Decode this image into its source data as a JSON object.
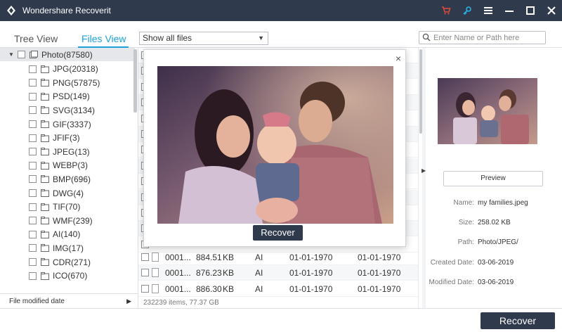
{
  "titlebar": {
    "app_name": "Wondershare Recoverit",
    "icons": [
      "logo-icon",
      "cart-icon",
      "key-icon",
      "menu-icon",
      "minimize-icon",
      "maximize-icon",
      "close-icon"
    ]
  },
  "toolbar": {
    "tab_tree": "Tree View",
    "tab_files": "Files View",
    "filter_value": "Show all files",
    "search_placeholder": "Enter Name or Path here"
  },
  "tree": {
    "root": {
      "label": "Photo(87580)"
    },
    "items": [
      {
        "label": "JPG(20318)"
      },
      {
        "label": "PNG(57875)"
      },
      {
        "label": "PSD(149)"
      },
      {
        "label": "SVG(3134)"
      },
      {
        "label": "GIF(3337)"
      },
      {
        "label": "JFIF(3)"
      },
      {
        "label": "JPEG(13)"
      },
      {
        "label": "WEBP(3)"
      },
      {
        "label": "BMP(696)"
      },
      {
        "label": "DWG(4)"
      },
      {
        "label": "TIF(70)"
      },
      {
        "label": "WMF(239)"
      },
      {
        "label": "AI(140)"
      },
      {
        "label": "IMG(17)"
      },
      {
        "label": "CDR(271)"
      },
      {
        "label": "ICO(670)"
      }
    ],
    "footer": "File modified date"
  },
  "list": {
    "rows": [
      {
        "name": "0001...",
        "size": "884.51",
        "unit": "KB",
        "type": "AI",
        "created": "01-01-1970",
        "modified": "01-01-1970"
      },
      {
        "name": "0001...",
        "size": "876.23",
        "unit": "KB",
        "type": "AI",
        "created": "01-01-1970",
        "modified": "01-01-1970"
      },
      {
        "name": "0001...",
        "size": "886.30",
        "unit": "KB",
        "type": "AI",
        "created": "01-01-1970",
        "modified": "01-01-1970"
      }
    ],
    "status": "232239 items, 77.37  GB"
  },
  "preview": {
    "button": "Preview",
    "meta": [
      {
        "label": "Name:",
        "value": "my families.jpeg"
      },
      {
        "label": "Size:",
        "value": "258.02  KB"
      },
      {
        "label": "Path:",
        "value": "Photo/JPEG/"
      },
      {
        "label": "Created Date:",
        "value": "03-06-2019"
      },
      {
        "label": "Modified Date:",
        "value": "03-06-2019"
      }
    ]
  },
  "modal": {
    "close": "×",
    "recover": "Recover"
  },
  "bottom": {
    "recover": "Recover"
  },
  "colors": {
    "titlebar": "#2f3a4c",
    "accent": "#1aa2d8",
    "cart": "#e04a3a"
  }
}
